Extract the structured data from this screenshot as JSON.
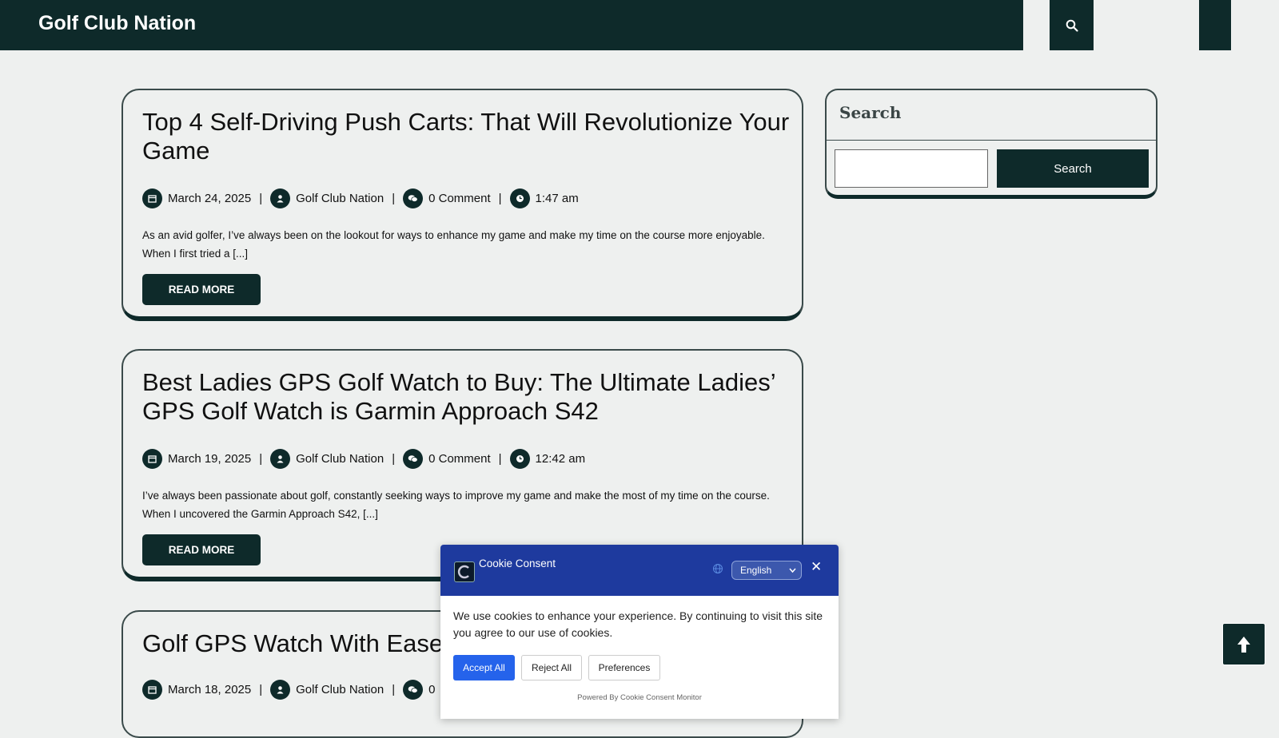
{
  "site": {
    "title": "Golf Club Nation"
  },
  "header": {
    "search_icon": "search-icon"
  },
  "posts": [
    {
      "title": "Top 4 Self-Driving Push Carts: That Will Revolutionize Your Game",
      "date": "March 24, 2025",
      "author": "Golf Club Nation",
      "comments": "0 Comment",
      "time": "1:47 am",
      "excerpt": "As an avid golfer, I’ve always been on the lookout for ways to enhance my game and make my time on the course more enjoyable. When I first tried a [...]",
      "read_more": "READ MORE"
    },
    {
      "title": "Best Ladies GPS Golf Watch to Buy: The Ultimate Ladies’ GPS Golf Watch is Garmin Approach S42",
      "date": "March 19, 2025",
      "author": "Golf Club Nation",
      "comments": "0 Comment",
      "time": "12:42 am",
      "excerpt": "I’ve always been passionate about golf, constantly seeking ways to improve my game and make the most of my time on the course. When I uncovered the Garmin Approach S42, [...]",
      "read_more": "READ MORE"
    },
    {
      "title": "Golf GPS Watch With Ease: A",
      "date": "March 18, 2025",
      "author": "Golf Club Nation",
      "comments": "0"
    }
  ],
  "sidebar": {
    "search_widget": {
      "title": "Search",
      "button_label": "Search",
      "input_value": ""
    }
  },
  "cookie_banner": {
    "title": "Cookie Consent",
    "language": "English",
    "close_label": "✕",
    "message": "We use cookies to enhance your experience. By continuing to visit this site you agree to our use of cookies.",
    "accept_label": "Accept All",
    "reject_label": "Reject All",
    "preferences_label": "Preferences",
    "powered_by": "Powered By Cookie Consent Monitor"
  },
  "scroll_top": {
    "icon": "arrow-up-icon"
  },
  "colors": {
    "brand": "#0e2a2a",
    "cookie_header": "#1e3a9e",
    "accept": "#2563eb"
  }
}
